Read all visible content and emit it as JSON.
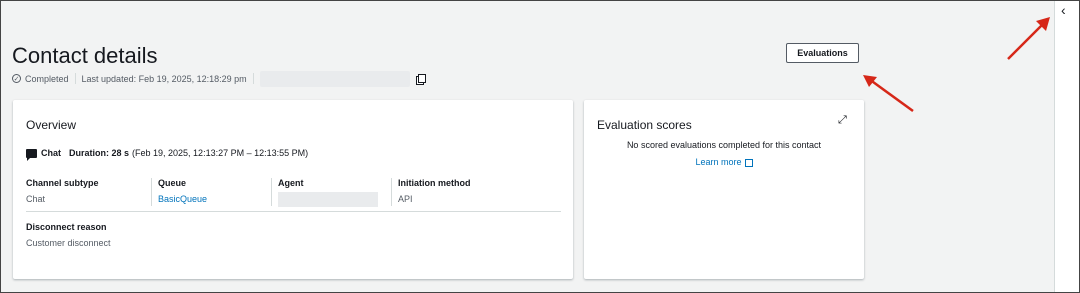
{
  "header": {
    "title": "Contact details",
    "status": "Completed",
    "last_updated": "Last updated: Feb 19, 2025, 12:18:29 pm"
  },
  "actions": {
    "evaluations_label": "Evaluations"
  },
  "overview": {
    "title": "Overview",
    "channel": "Chat",
    "duration_label": "Duration: 28 s",
    "duration_range": "(Feb 19, 2025, 12:13:27 PM – 12:13:55 PM)",
    "fields": [
      {
        "label": "Channel subtype",
        "value": "Chat"
      },
      {
        "label": "Queue",
        "value": "BasicQueue"
      },
      {
        "label": "Agent",
        "value": ""
      },
      {
        "label": "Initiation method",
        "value": "API"
      }
    ],
    "disconnect_label": "Disconnect reason",
    "disconnect_value": "Customer disconnect"
  },
  "evaluation_scores": {
    "title": "Evaluation scores",
    "empty_text": "No scored evaluations completed for this contact",
    "learn_more": "Learn more"
  },
  "colors": {
    "link": "#0073bb",
    "annotation_arrow": "#d62718"
  }
}
